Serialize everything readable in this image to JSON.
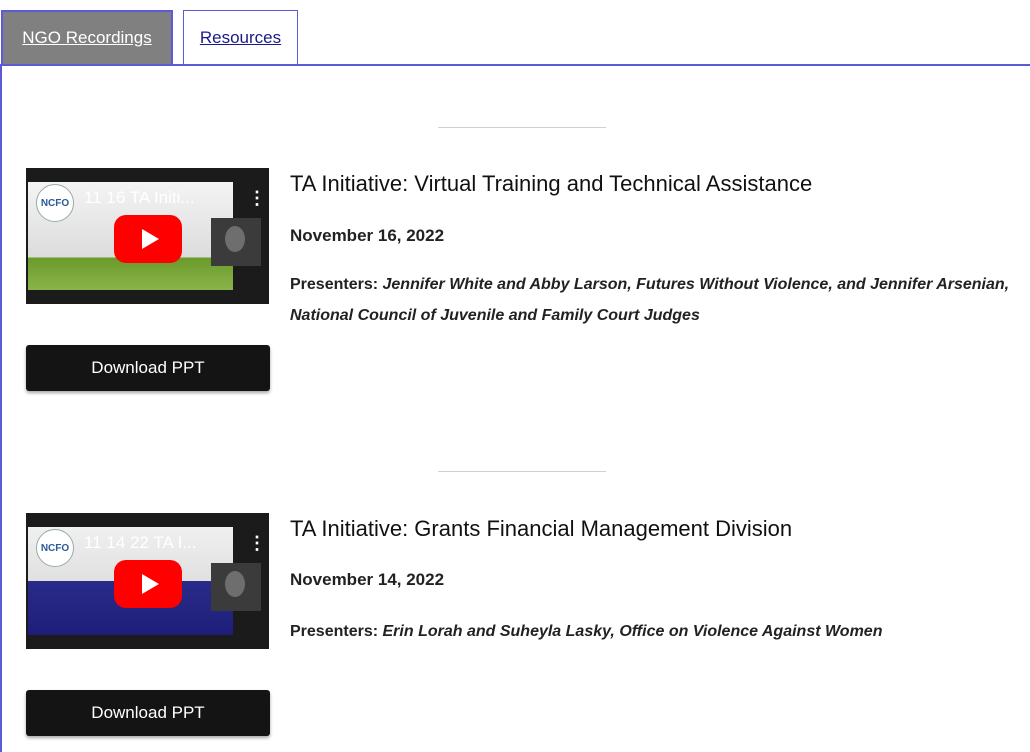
{
  "tabs": [
    {
      "label": "NGO Recordings",
      "active": true
    },
    {
      "label": "Resources",
      "active": false
    }
  ],
  "recordings": [
    {
      "video_logo": "NCFO",
      "video_title": "11 16 TA Initi...",
      "title": "TA Initiative: Virtual Training and Technical Assistance",
      "date": "November 16, 2022",
      "presenters_label": "Presenters:",
      "presenters": "Jennifer White and Abby Larson, Futures Without Violence, and Jennifer Arsenian, National Council of Juvenile and Family Court Judges",
      "download_label": "Download PPT"
    },
    {
      "video_logo": "NCFO",
      "video_title": "11 14 22 TA I...",
      "title": "TA Initiative: Grants Financial Management Division",
      "date": "November 14, 2022",
      "presenters_label": "Presenters:",
      "presenters": "Erin Lorah and Suheyla Lasky, Office on Violence Against Women",
      "download_label": "Download PPT"
    }
  ],
  "icons": {
    "play": "youtube-play-icon",
    "more": "more-vertical-icon"
  },
  "colors": {
    "tab_border": "#5b5bd6",
    "tab_active_bg": "#808080",
    "button_bg": "#141414",
    "play_button": "#ff0000"
  }
}
